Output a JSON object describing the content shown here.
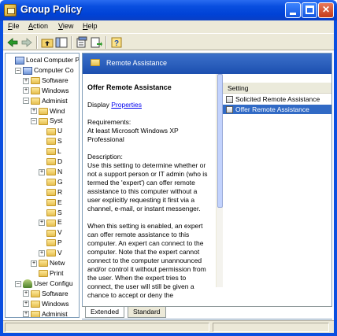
{
  "window": {
    "title": "Group Policy"
  },
  "menu": [
    "File",
    "Action",
    "View",
    "Help"
  ],
  "toolbar_icons": [
    "back-icon",
    "forward-icon",
    "up-folder-icon",
    "show-hide-tree-icon",
    "properties-icon",
    "export-list-icon",
    "help-icon"
  ],
  "tree": [
    {
      "label": "Local Computer P",
      "indent": 0,
      "expander": "",
      "icon": "computer"
    },
    {
      "label": "Computer Co",
      "indent": 1,
      "expander": "-",
      "icon": "computer"
    },
    {
      "label": "Software",
      "indent": 2,
      "expander": "+",
      "icon": "folder"
    },
    {
      "label": "Windows",
      "indent": 2,
      "expander": "+",
      "icon": "folder"
    },
    {
      "label": "Administ",
      "indent": 2,
      "expander": "-",
      "icon": "folder"
    },
    {
      "label": "Wind",
      "indent": 3,
      "expander": "+",
      "icon": "folder"
    },
    {
      "label": "Syst",
      "indent": 3,
      "expander": "-",
      "icon": "folder"
    },
    {
      "label": "U",
      "indent": 4,
      "expander": "",
      "icon": "folder"
    },
    {
      "label": "S",
      "indent": 4,
      "expander": "",
      "icon": "folder"
    },
    {
      "label": "L",
      "indent": 4,
      "expander": "",
      "icon": "folder"
    },
    {
      "label": "D",
      "indent": 4,
      "expander": "",
      "icon": "folder"
    },
    {
      "label": "N",
      "indent": 4,
      "expander": "+",
      "icon": "folder"
    },
    {
      "label": "G",
      "indent": 4,
      "expander": "",
      "icon": "folder"
    },
    {
      "label": "R",
      "indent": 4,
      "expander": "",
      "icon": "folder"
    },
    {
      "label": "E",
      "indent": 4,
      "expander": "",
      "icon": "folder"
    },
    {
      "label": "S",
      "indent": 4,
      "expander": "",
      "icon": "folder"
    },
    {
      "label": "E",
      "indent": 4,
      "expander": "+",
      "icon": "folder"
    },
    {
      "label": "V",
      "indent": 4,
      "expander": "",
      "icon": "folder"
    },
    {
      "label": "P",
      "indent": 4,
      "expander": "",
      "icon": "folder"
    },
    {
      "label": "V",
      "indent": 4,
      "expander": "+",
      "icon": "folder"
    },
    {
      "label": "Netw",
      "indent": 3,
      "expander": "+",
      "icon": "folder"
    },
    {
      "label": "Print",
      "indent": 3,
      "expander": "",
      "icon": "folder"
    },
    {
      "label": "User Configu",
      "indent": 1,
      "expander": "-",
      "icon": "user"
    },
    {
      "label": "Software",
      "indent": 2,
      "expander": "+",
      "icon": "folder"
    },
    {
      "label": "Windows",
      "indent": 2,
      "expander": "+",
      "icon": "folder"
    },
    {
      "label": "Administ",
      "indent": 2,
      "expander": "+",
      "icon": "folder"
    }
  ],
  "panel": {
    "header": "Remote Assistance",
    "title": "Offer Remote Assistance",
    "display_prefix": "Display",
    "display_link": "Properties",
    "requirements": "Requirements:\nAt least Microsoft Windows XP Professional",
    "description": "Description:\nUse this setting to determine whether or not a support person or IT admin (who is termed the 'expert') can offer remote assistance to this computer without a user explicitly requesting it first via a channel, e-mail, or instant messenger.",
    "paragraph2": "When this setting is enabled, an expert can offer remote assistance to this computer.  An expert can connect to the computer.  Note that the expert cannot connect to the computer unannounced and/or control it without permission from the user.  When the expert tries to connect, the user will still be given a chance to accept or deny the"
  },
  "list": {
    "column_header": "Setting",
    "items": [
      {
        "label": "Solicited Remote Assistance",
        "selected": false
      },
      {
        "label": "Offer Remote Assistance",
        "selected": true
      }
    ]
  },
  "tabs": [
    "Extended",
    "Standard"
  ]
}
